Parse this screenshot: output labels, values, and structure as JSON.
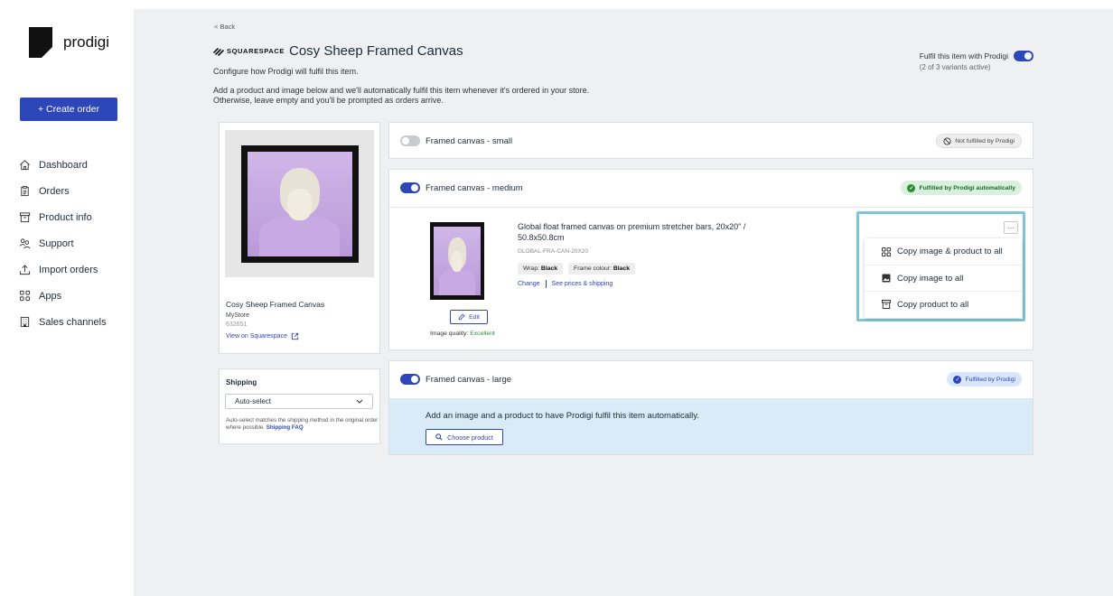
{
  "sidebar": {
    "logo_text": "prodigi",
    "create_order": "+ Create order",
    "nav": [
      {
        "label": "Dashboard",
        "icon": "home-icon"
      },
      {
        "label": "Orders",
        "icon": "clipboard-icon"
      },
      {
        "label": "Product info",
        "icon": "archive-icon"
      },
      {
        "label": "Support",
        "icon": "people-icon"
      },
      {
        "label": "Import orders",
        "icon": "upload-icon"
      },
      {
        "label": "Apps",
        "icon": "grid-icon"
      },
      {
        "label": "Sales channels",
        "icon": "building-icon"
      }
    ]
  },
  "header": {
    "back": "< Back",
    "platform": "SQUARESPACE",
    "title": "Cosy Sheep Framed Canvas",
    "subtitle": "Configure how Prodigi will fulfil this item.",
    "desc1": "Add a product and image below and we'll automatically fulfil this item whenever it's ordered in your store.",
    "desc2": "Otherwise, leave empty and you'll be prompted as orders arrive.",
    "fulfil_label": "Fulfil this item with Prodigi",
    "fulfil_sub": "(2 of 3 variants active)"
  },
  "product": {
    "name": "Cosy Sheep Framed Canvas",
    "store": "MyStore",
    "id": "632651",
    "view_link": "View on Squarespace"
  },
  "shipping": {
    "label": "Shipping",
    "selected": "Auto-select",
    "help": "Auto-select matches the shipping method in the original order where possible.",
    "faq": "Shipping FAQ"
  },
  "variants": {
    "small": {
      "label": "Framed canvas - small",
      "status": "Not fulfilled by Prodigi",
      "enabled": false
    },
    "medium": {
      "label": "Framed canvas - medium",
      "status": "Fulfilled by Prodigi automatically",
      "enabled": true,
      "product_title": "Global float framed canvas on premium stretcher bars, 20x20\" / 50.8x50.8cm",
      "sku": "GLOBAL-FRA-CAN-20X20",
      "wrap_label": "Wrap:",
      "wrap_value": "Black",
      "frame_label": "Frame colour:",
      "frame_value": "Black",
      "change": "Change",
      "prices": "See prices & shipping",
      "edit": "Edit",
      "quality_label": "Image quality:",
      "quality_value": "Excellent"
    },
    "large": {
      "label": "Framed canvas - large",
      "status": "Fulfilled by Prodigi",
      "enabled": true,
      "message": "Add an image and a product to have Prodigi fulfil this item automatically.",
      "choose": "Choose product"
    }
  },
  "menu": {
    "kebab": "···",
    "items": [
      {
        "label": "Copy image & product to all",
        "icon": "grid-icon"
      },
      {
        "label": "Copy image to all",
        "icon": "image-icon"
      },
      {
        "label": "Copy product to all",
        "icon": "archive-icon"
      }
    ]
  },
  "colors": {
    "accent": "#2d47b8",
    "success": "#2c8a3c",
    "highlight": "#7ec5d6"
  }
}
